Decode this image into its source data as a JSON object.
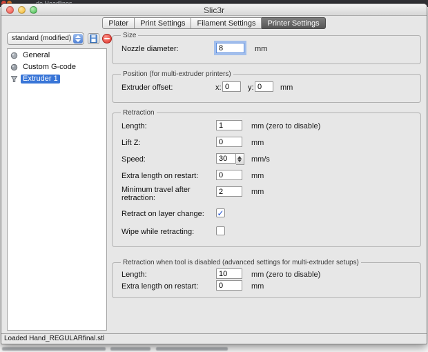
{
  "colors": {
    "selection_blue": "#3875d7",
    "tab_active": "#565656",
    "focus_ring": "#699df0",
    "delete_red": "#dd3329"
  },
  "background": {
    "top_text": "de Headlines"
  },
  "window": {
    "title": "Slic3r",
    "status": "Loaded Hand_REGULARfinal.stl"
  },
  "tabs": [
    {
      "label": "Plater"
    },
    {
      "label": "Print Settings"
    },
    {
      "label": "Filament Settings"
    },
    {
      "label": "Printer Settings"
    }
  ],
  "sidebar": {
    "preset": "standard (modified)",
    "items": [
      {
        "label": "General",
        "selected": false
      },
      {
        "label": "Custom G-code",
        "selected": false
      },
      {
        "label": "Extruder 1",
        "selected": true
      }
    ]
  },
  "size_section": {
    "legend": "Size",
    "nozzle": {
      "label": "Nozzle diameter:",
      "value": "8",
      "unit": "mm"
    }
  },
  "position_section": {
    "legend": "Position (for multi-extruder printers)",
    "offset_label": "Extruder offset:",
    "x_label": "x:",
    "x_value": "0",
    "y_label": "y:",
    "y_value": "0",
    "unit": "mm"
  },
  "retraction_section": {
    "legend": "Retraction",
    "rows": [
      {
        "label": "Length:",
        "value": "1",
        "unit": "mm (zero to disable)"
      },
      {
        "label": "Lift Z:",
        "value": "0",
        "unit": "mm"
      },
      {
        "label": "Speed:",
        "value": "30",
        "unit": "mm/s"
      },
      {
        "label": "Extra length on restart:",
        "value": "0",
        "unit": "mm"
      },
      {
        "label": "Minimum travel after retraction:",
        "value": "2",
        "unit": "mm"
      },
      {
        "label": "Retract on layer change:",
        "checked": true,
        "mark": "✓"
      },
      {
        "label": "Wipe while retracting:",
        "checked": false,
        "mark": ""
      }
    ]
  },
  "disabled_section": {
    "legend": "Retraction when tool is disabled (advanced settings for multi-extruder setups)",
    "rows": [
      {
        "label": "Length:",
        "value": "10",
        "unit": "mm (zero to disable)"
      },
      {
        "label": "Extra length on restart:",
        "value": "0",
        "unit": "mm"
      }
    ]
  }
}
